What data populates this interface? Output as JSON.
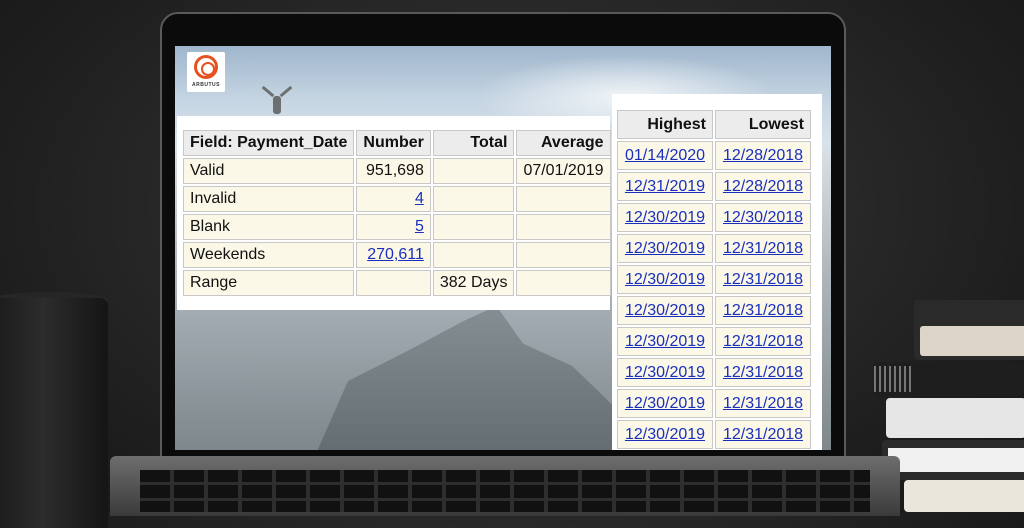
{
  "summary": {
    "columns": [
      "Field: Payment_Date",
      "Number",
      "Total",
      "Average"
    ],
    "rows": [
      {
        "label": "Valid",
        "number": "951,698",
        "number_link": false,
        "total": "",
        "average": "07/01/2019"
      },
      {
        "label": "Invalid",
        "number": "4",
        "number_link": true,
        "total": "",
        "average": ""
      },
      {
        "label": "Blank",
        "number": "5",
        "number_link": true,
        "total": "",
        "average": ""
      },
      {
        "label": "Weekends",
        "number": "270,611",
        "number_link": true,
        "total": "",
        "average": ""
      },
      {
        "label": "Range",
        "number": "",
        "number_link": false,
        "total": "382 Days",
        "average": ""
      }
    ]
  },
  "extremes": {
    "columns": [
      "Highest",
      "Lowest"
    ],
    "rows": [
      [
        "01/14/2020",
        "12/28/2018"
      ],
      [
        "12/31/2019",
        "12/28/2018"
      ],
      [
        "12/30/2019",
        "12/30/2018"
      ],
      [
        "12/30/2019",
        "12/31/2018"
      ],
      [
        "12/30/2019",
        "12/31/2018"
      ],
      [
        "12/30/2019",
        "12/31/2018"
      ],
      [
        "12/30/2019",
        "12/31/2018"
      ],
      [
        "12/30/2019",
        "12/31/2018"
      ],
      [
        "12/30/2019",
        "12/31/2018"
      ],
      [
        "12/30/2019",
        "12/31/2018"
      ]
    ]
  },
  "logo": {
    "text": "ARBUTUS",
    "icon": "arbutus-logo-icon",
    "color": "#e8501f"
  },
  "colors": {
    "link": "#1a2fbb",
    "cell_bg": "#fbf8e8",
    "header_bg": "#ececec"
  }
}
